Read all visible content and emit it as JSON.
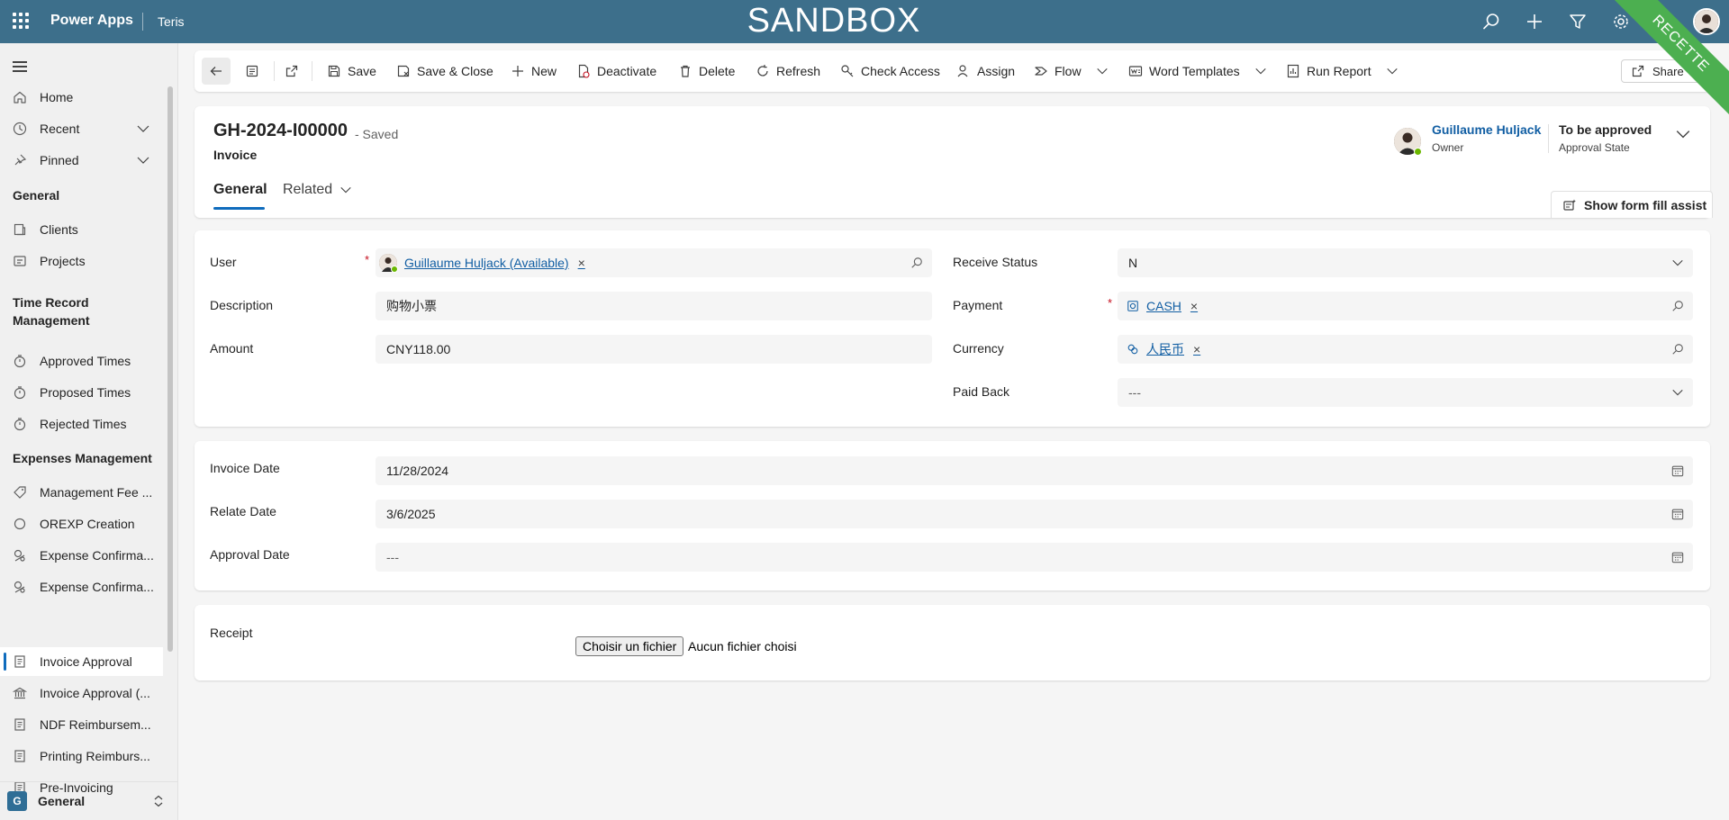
{
  "topbar": {
    "app_name": "Power Apps",
    "environment": "Teris",
    "banner": "SANDBOX",
    "ribbon": "RECETTE"
  },
  "sidebar": {
    "items_top": [
      {
        "label": "Home",
        "icon": "home-icon"
      },
      {
        "label": "Recent",
        "icon": "clock-icon"
      },
      {
        "label": "Pinned",
        "icon": "pin-icon"
      }
    ],
    "sections": [
      {
        "title": "General",
        "items": [
          {
            "label": "Clients",
            "icon": "clients-icon"
          },
          {
            "label": "Projects",
            "icon": "projects-icon"
          }
        ]
      },
      {
        "title": "Time Record Management",
        "items": [
          {
            "label": "Approved Times",
            "icon": "timer-icon"
          },
          {
            "label": "Proposed Times",
            "icon": "timer-icon"
          },
          {
            "label": "Rejected Times",
            "icon": "timer-icon"
          }
        ]
      },
      {
        "title": "Expenses Management",
        "items": [
          {
            "label": "Management Fee ...",
            "icon": "tag-icon"
          },
          {
            "label": "OREXP Creation",
            "icon": "circle-icon"
          },
          {
            "label": "Expense Confirma...",
            "icon": "money-icon"
          },
          {
            "label": "Expense Confirma...",
            "icon": "money-icon"
          },
          {
            "label": "Invoice Approval",
            "icon": "document-icon"
          },
          {
            "label": "Invoice Approval (...",
            "icon": "bank-icon"
          },
          {
            "label": "NDF Reimbursem...",
            "icon": "document-icon"
          },
          {
            "label": "Printing Reimburs...",
            "icon": "document-icon"
          },
          {
            "label": "Pre-Invoicing",
            "icon": "document-icon"
          }
        ]
      }
    ],
    "area": {
      "badge": "G",
      "label": "General"
    }
  },
  "commands": {
    "save": "Save",
    "save_close": "Save & Close",
    "new": "New",
    "deactivate": "Deactivate",
    "delete": "Delete",
    "refresh": "Refresh",
    "check_access": "Check Access",
    "assign": "Assign",
    "flow": "Flow",
    "word_templates": "Word Templates",
    "run_report": "Run Report",
    "share": "Share"
  },
  "record": {
    "title": "GH-2024-I00000",
    "saved_status": "- Saved",
    "entity": "Invoice",
    "tabs": [
      "General",
      "Related"
    ],
    "owner_name": "Guillaume Huljack",
    "owner_label": "Owner",
    "approval_state_value": "To be approved",
    "approval_state_label": "Approval State",
    "form_fill_assist": "Show form fill assist"
  },
  "form": {
    "user_label": "User",
    "user_value": "Guillaume Huljack (Available)",
    "description_label": "Description",
    "description_value": "购物小票",
    "amount_label": "Amount",
    "amount_value": "CNY118.00",
    "receive_status_label": "Receive Status",
    "receive_status_value": "N",
    "payment_label": "Payment",
    "payment_value": "CASH",
    "currency_label": "Currency",
    "currency_value": "人民币",
    "paid_back_label": "Paid Back",
    "paid_back_value": "---",
    "invoice_date_label": "Invoice Date",
    "invoice_date_value": "11/28/2024",
    "relate_date_label": "Relate Date",
    "relate_date_value": "3/6/2025",
    "approval_date_label": "Approval Date",
    "approval_date_value": "---",
    "receipt_label": "Receipt",
    "file_button": "Choisir un fichier",
    "file_status": "Aucun fichier choisi",
    "required_mark": "*",
    "remove_mark": "×"
  },
  "colors": {
    "topbar": "#3d6f8b",
    "accent": "#0f6cbd",
    "link": "#115ea3",
    "ribbon": "#4caf50",
    "required": "#c50f1f"
  }
}
